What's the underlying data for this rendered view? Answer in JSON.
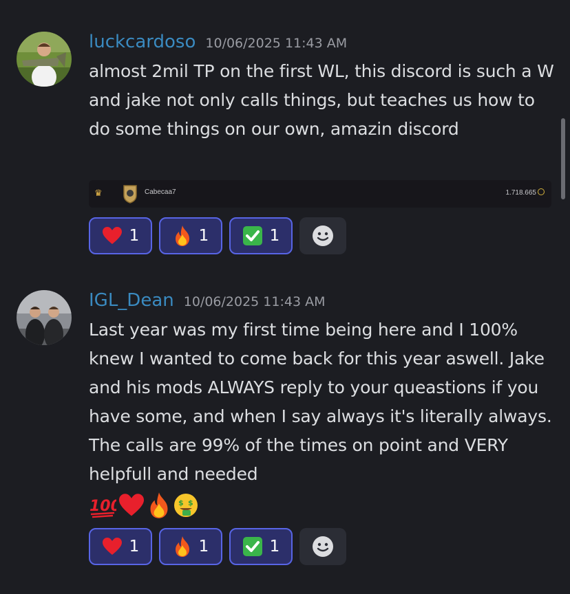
{
  "messages": [
    {
      "username": "luckcardoso",
      "timestamp": "10/06/2025 11:43 AM",
      "text": "almost 2mil TP on the first WL, this discord is such a W and jake not only calls things, but teaches us how to do some things on our own, amazin discord",
      "avatar_icon": "user-holding-fish-photo",
      "embed": {
        "rank_icon": "crown-icon",
        "name": "Cabecaa7",
        "score": "1.718.665",
        "score_icon": "coin-icon"
      },
      "reactions": [
        {
          "emoji": "❤️",
          "icon": "red-heart-icon",
          "count": "1"
        },
        {
          "emoji": "🔥",
          "icon": "fire-icon",
          "count": "1"
        },
        {
          "emoji": "✅",
          "icon": "check-mark-button-icon",
          "count": "1"
        }
      ]
    },
    {
      "username": "IGL_Dean",
      "timestamp": "10/06/2025 11:43 AM",
      "text": "Last year was my first time being here and I 100% knew I wanted to come back for this year aswell. Jake and his mods ALWAYS reply to your queastions if you have some, and when I say always it's literally always. The calls are 99% of the times on point and VERY helpfull and needed",
      "avatar_icon": "group-photo",
      "trailing_emojis": [
        {
          "emoji": "💯",
          "icon": "hundred-points-icon"
        },
        {
          "emoji": "❤️",
          "icon": "red-heart-icon"
        },
        {
          "emoji": "🔥",
          "icon": "fire-icon"
        },
        {
          "emoji": "🤑",
          "icon": "money-mouth-face-icon"
        }
      ],
      "reactions": [
        {
          "emoji": "❤️",
          "icon": "red-heart-icon",
          "count": "1"
        },
        {
          "emoji": "🔥",
          "icon": "fire-icon",
          "count": "1"
        },
        {
          "emoji": "✅",
          "icon": "check-mark-button-icon",
          "count": "1"
        }
      ]
    }
  ],
  "colors": {
    "background": "#1c1d22",
    "username": "#3a8ac0",
    "reaction_bg": "#2c2f6a",
    "reaction_border": "#5865e6"
  }
}
